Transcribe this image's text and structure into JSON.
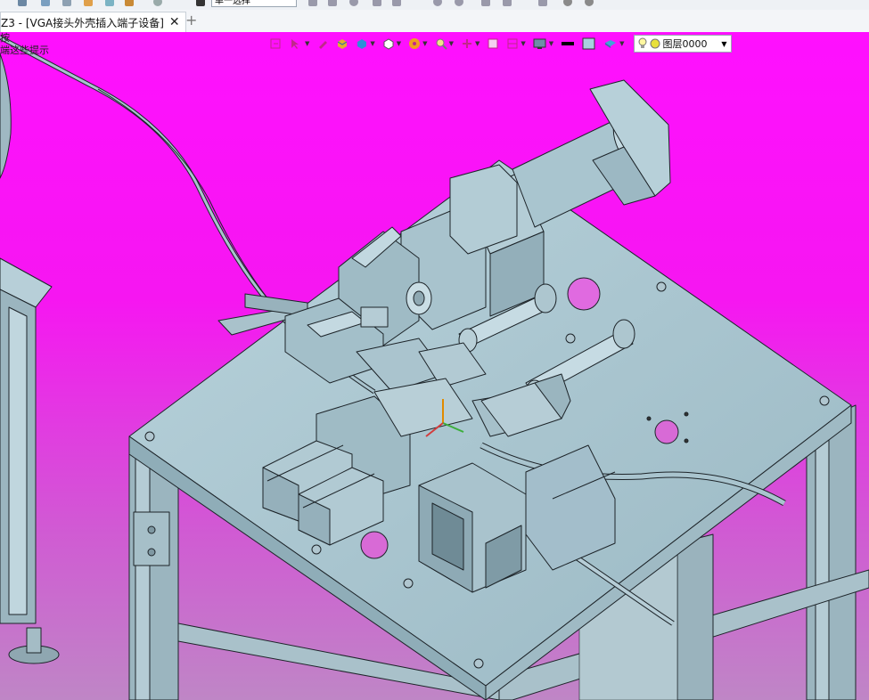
{
  "ribbon": {
    "select_label": "单一选择"
  },
  "tab": {
    "title": "Z3 - [VGA接头外壳插入端子设备]",
    "close": "✕",
    "add": "+"
  },
  "hint": {
    "line1": "按",
    "line2": "端这些提示"
  },
  "viewport_toolbar": {
    "layer_value": "图层0000",
    "icons": [
      "layer-entry-icon",
      "select-filter-icon",
      "pin-icon",
      "shaded-cube-icon",
      "view-cube-icon",
      "white-cube-icon",
      "render-mode-icon",
      "zoom-icon",
      "axis-icon",
      "frame-icon",
      "section-icon",
      "display-icon",
      "line-color-icon",
      "fill-color-icon",
      "material-icon"
    ]
  },
  "colors": {
    "background_top": "#ff10ff",
    "background_bottom": "#bf86c6",
    "part": "#a7c3cd",
    "edge": "#1d2429"
  }
}
